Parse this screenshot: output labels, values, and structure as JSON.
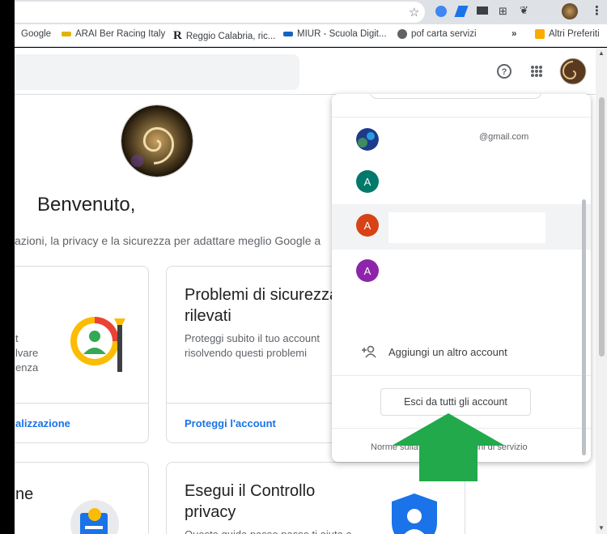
{
  "browser": {
    "bookmarks": [
      {
        "label": "Google",
        "color": "#ffffff"
      },
      {
        "label": "ARAI Ber Racing Italy",
        "color": "#e0b400"
      },
      {
        "label": "Reggio Calabria, ric...",
        "color": "#202124"
      },
      {
        "label": "MIUR - Scuola Digit...",
        "color": "#1565c0"
      },
      {
        "label": "pof carta servizi",
        "color": "#5f6368"
      },
      {
        "label": "»",
        "color": "#5f6368"
      },
      {
        "label": "Altri Preferiti",
        "color": "#f9ab00"
      }
    ]
  },
  "page": {
    "welcome": "Benvenuto,",
    "subtitle": "azioni, la privacy e la sicurezza per adattare meglio Google a",
    "cards": [
      {
        "title": "",
        "text_lines": [
          "t",
          "lvare",
          "enza"
        ],
        "link": "alizzazione"
      },
      {
        "title": "Problemi di sicurezza rilevati",
        "text": "Proteggi subito il tuo account risolvendo questi problemi",
        "link": "Proteggi l'account"
      },
      {
        "title": "ne",
        "text": "",
        "link": ""
      },
      {
        "title": "Esegui il Controllo privacy",
        "text": "Questa guida passo passo ti aiuta a",
        "link": ""
      }
    ]
  },
  "account_menu": {
    "accounts": [
      {
        "initial": "",
        "email": "@gmail.com",
        "color": "#1e3a8a"
      },
      {
        "initial": "A",
        "email": "",
        "color": "#00796b"
      },
      {
        "initial": "A",
        "email": "",
        "color": "#d84315"
      },
      {
        "initial": "A",
        "email": "",
        "color": "#8e24aa"
      }
    ],
    "add_account": "Aggiungi un altro account",
    "sign_out_all": "Esci da tutti gli account",
    "footer": "Norme sulla privacy · Termini di servizio"
  },
  "colors": {
    "accent": "#1a73e8",
    "arrow": "#22a94b"
  }
}
